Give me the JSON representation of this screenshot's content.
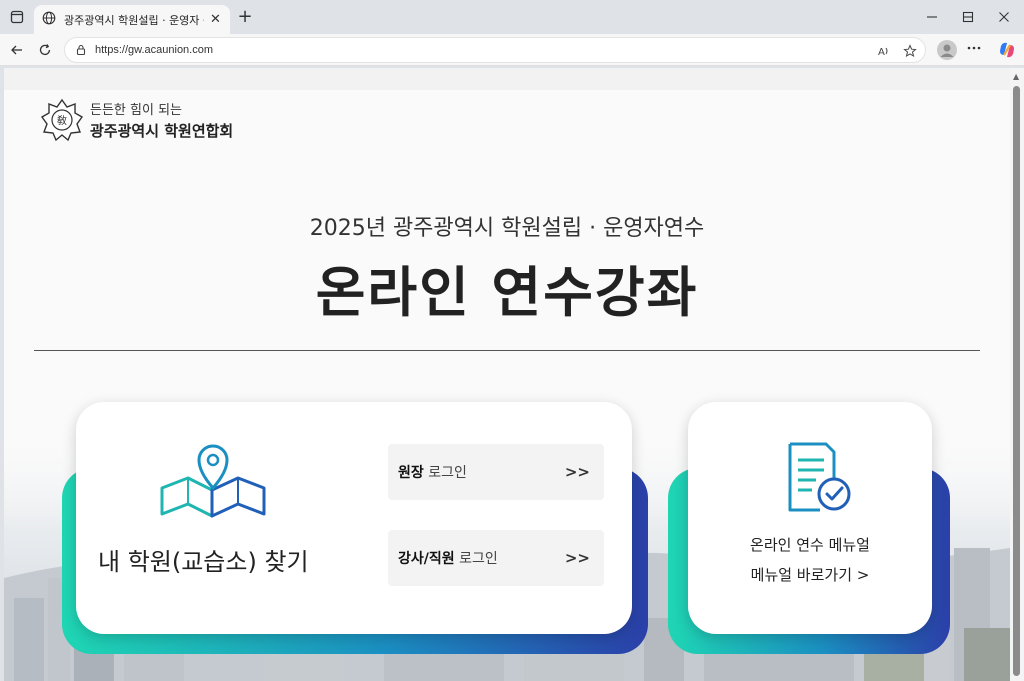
{
  "browser": {
    "tab_title": "광주광역시 학원설립 · 운영자 등",
    "tab_close": "✕",
    "new_tab": "+",
    "url": "https://gw.acaunion.com"
  },
  "header": {
    "logo_sub": "든든한 힘이 되는",
    "logo_main": "광주광역시 학원연합회"
  },
  "hero": {
    "subtitle": "2025년 광주광역시 학원설립 · 운영자연수",
    "title": "온라인 연수강좌"
  },
  "card_left": {
    "find_label": "내 학원(교습소) 찾기",
    "login_director_bold": "원장",
    "login_director_rest": " 로그인",
    "login_staff_bold": "강사/직원",
    "login_staff_rest": " 로그인",
    "arrow": ">>"
  },
  "card_right": {
    "line1": "온라인 연수 메뉴얼",
    "line2": "메뉴얼 바로가기 >"
  },
  "colors": {
    "gradient_start": "#1fd6b3",
    "gradient_mid": "#1b8fc2",
    "gradient_end": "#2b3fa8",
    "icon_teal": "#1fb5b0",
    "icon_blue": "#2060b8"
  }
}
